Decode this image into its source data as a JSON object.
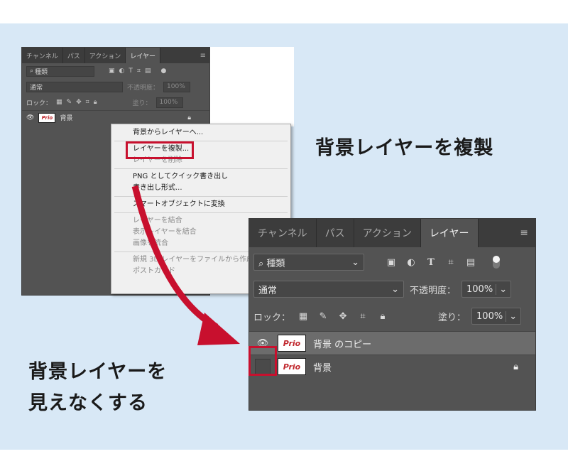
{
  "small_panel": {
    "tabs": [
      "チャンネル",
      "パス",
      "アクション",
      "レイヤー"
    ],
    "active_tab_index": 3,
    "filter_label": "種類",
    "blend_mode": "通常",
    "opacity_label": "不透明度：",
    "opacity_value": "100%",
    "lock_label": "ロック：",
    "fill_label": "塗り：",
    "fill_value": "100%",
    "layer_name": "背景",
    "thumb_text": "Prio"
  },
  "context_menu": {
    "items": [
      {
        "label": "背景からレイヤーへ...",
        "disabled": false
      },
      {
        "label": "レイヤーを複製...",
        "disabled": false,
        "highlighted": true
      },
      {
        "label": "レイヤーを削除",
        "disabled": true
      },
      {
        "label": "PNG としてクイック書き出し",
        "disabled": false
      },
      {
        "label": "書き出し形式...",
        "disabled": false
      },
      {
        "label": "スマートオブジェクトに変換",
        "disabled": false
      },
      {
        "label": "レイヤーを結合",
        "disabled": true
      },
      {
        "label": "表示レイヤーを結合",
        "disabled": true
      },
      {
        "label": "画像を統合",
        "disabled": true
      },
      {
        "label": "新規 3D レイヤーをファイルから作成...",
        "disabled": true
      },
      {
        "label": "ポストカード",
        "disabled": true
      }
    ]
  },
  "big_panel": {
    "tabs": [
      "チャンネル",
      "パス",
      "アクション",
      "レイヤー"
    ],
    "active_tab_index": 3,
    "menu_icon": "≡",
    "filter_label": "種類",
    "blend_mode": "通常",
    "opacity_label": "不透明度：",
    "opacity_value": "100%",
    "lock_label": "ロック：",
    "fill_label": "塗り：",
    "fill_value": "100%",
    "layers": [
      {
        "name": "背景 のコピー",
        "visible": true,
        "locked": false,
        "selected": true
      },
      {
        "name": "背景",
        "visible": false,
        "locked": true,
        "selected": false
      }
    ],
    "thumb_text": "Prio"
  },
  "captions": {
    "duplicate": "背景レイヤーを複製",
    "hide_line1": "背景レイヤーを",
    "hide_line2": "見えなくする"
  },
  "colors": {
    "highlight": "#c8102e",
    "background": "#d8e8f6",
    "panel": "#535353"
  }
}
